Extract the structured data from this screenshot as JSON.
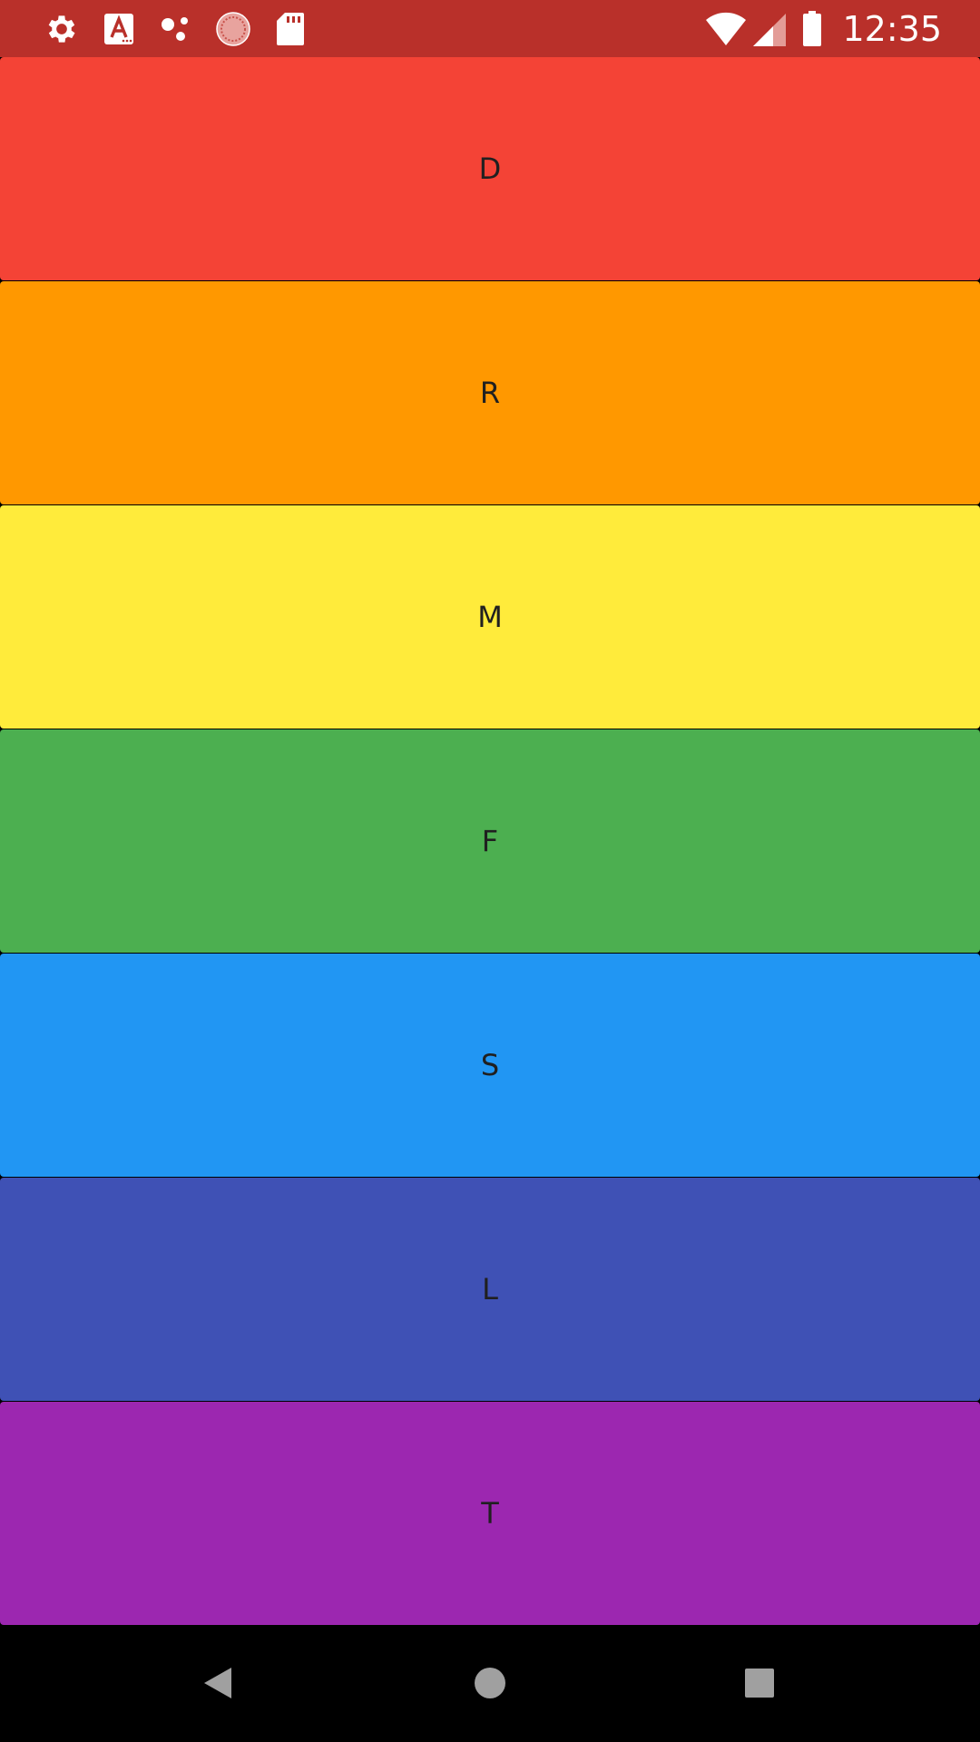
{
  "status_bar": {
    "background": "#B9302A",
    "time": "12:35",
    "left_icons": [
      "settings-icon",
      "font-a-icon",
      "dots-icon",
      "loading-circle-icon",
      "sd-card-icon"
    ],
    "right_icons": [
      "wifi-icon",
      "signal-icon",
      "battery-icon"
    ]
  },
  "tiles": [
    {
      "letter": "D",
      "color": "#F44336"
    },
    {
      "letter": "R",
      "color": "#FF9800"
    },
    {
      "letter": "M",
      "color": "#FFEB3B"
    },
    {
      "letter": "F",
      "color": "#4CAF50"
    },
    {
      "letter": "S",
      "color": "#2196F3"
    },
    {
      "letter": "L",
      "color": "#3F51B5"
    },
    {
      "letter": "T",
      "color": "#9C27B0"
    }
  ],
  "nav_bar": {
    "buttons": [
      "back-icon",
      "home-icon",
      "recents-icon"
    ],
    "icon_color": "#A0A0A0"
  }
}
